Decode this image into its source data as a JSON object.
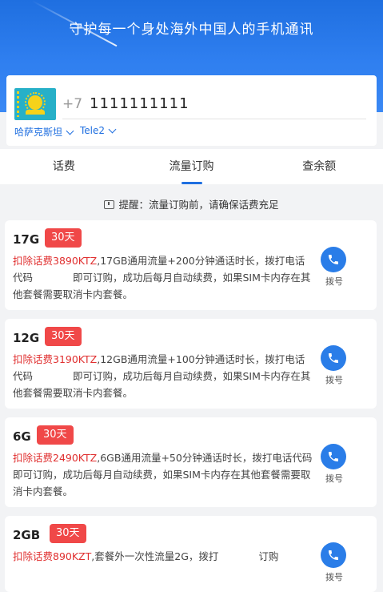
{
  "header": {
    "slogan": "守护每一个身处海外中国人的手机通讯"
  },
  "phone": {
    "country_code": "+7",
    "number": "1111111111",
    "country": "哈萨克斯坦",
    "operator": "Tele2",
    "flag_icon": "kazakhstan-flag-icon"
  },
  "tabs": [
    {
      "label": "话费"
    },
    {
      "label": "流量订购"
    },
    {
      "label": "查余额"
    }
  ],
  "notice": "提醒：流量订购前，请确保话费充足",
  "call_label": "拨号",
  "plans": [
    {
      "name": "17G",
      "period": "30天",
      "price": "扣除话费3890KTZ",
      "desc": ",17GB通用流量+200分钟通话时长，拨打电话代码　　　　即可订购，成功后每月自动续费，如果SIM卡内存在其他套餐需要取消卡内套餐。"
    },
    {
      "name": "12G",
      "period": "30天",
      "price": "扣除话费3190KTZ",
      "desc": ",12GB通用流量+100分钟通话时长，拨打电话代码　　　　即可订购，成功后每月自动续费，如果SIM卡内存在其他套餐需要取消卡内套餐。"
    },
    {
      "name": "6G",
      "period": "30天",
      "price": "扣除话费2490KTZ",
      "desc": ",6GB通用流量+50分钟通话时长，拨打电话代码　　　　即可订购，成功后每月自动续费，如果SIM卡内存在其他套餐需要取消卡内套餐。"
    },
    {
      "name": "2GB",
      "period": "30天",
      "price": "扣除话费890KZT",
      "desc": ",套餐外一次性流量2G，拨打　　　　订购"
    }
  ],
  "colors": {
    "primary": "#1f6fe0",
    "badge": "#f04848",
    "price": "#e02f2f"
  }
}
